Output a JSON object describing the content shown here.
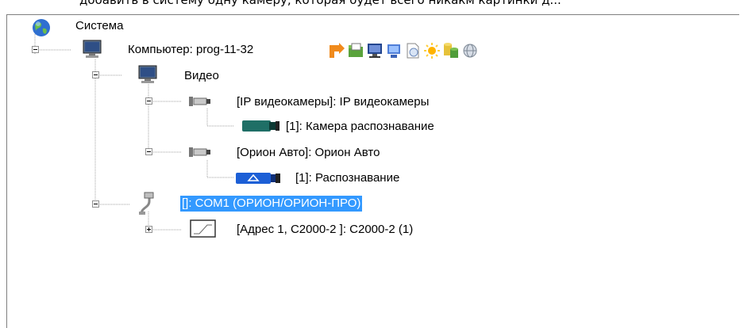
{
  "caption": "добавить в систему одну камеру, которая будет всего никакм картинки д...",
  "tree": {
    "root": "Система",
    "computer": "Компьютер: prog-11-32",
    "video": "Видео",
    "ip_cameras": "[IP видеокамеры]: IP видеокамеры",
    "camera_recognition": "[1]: Камера распознавание",
    "orion_auto": "[Орион Авто]: Орион Авто",
    "recognition": "[1]: Распознавание",
    "com_port": "[]: COM1 (ОРИОН/ОРИОН-ПРО)",
    "address": "[Адрес 1, С2000-2 ]: С2000-2 (1)"
  },
  "selected_item": "com_port",
  "computer_toolbar_icons": [
    "arrow-icon",
    "folder-icon",
    "monitor-icon",
    "display-icon",
    "document-icon",
    "sun-icon",
    "database-icon",
    "globe-icon"
  ],
  "colors": {
    "selection": "#3399ff",
    "tree_lines": "#919191"
  }
}
